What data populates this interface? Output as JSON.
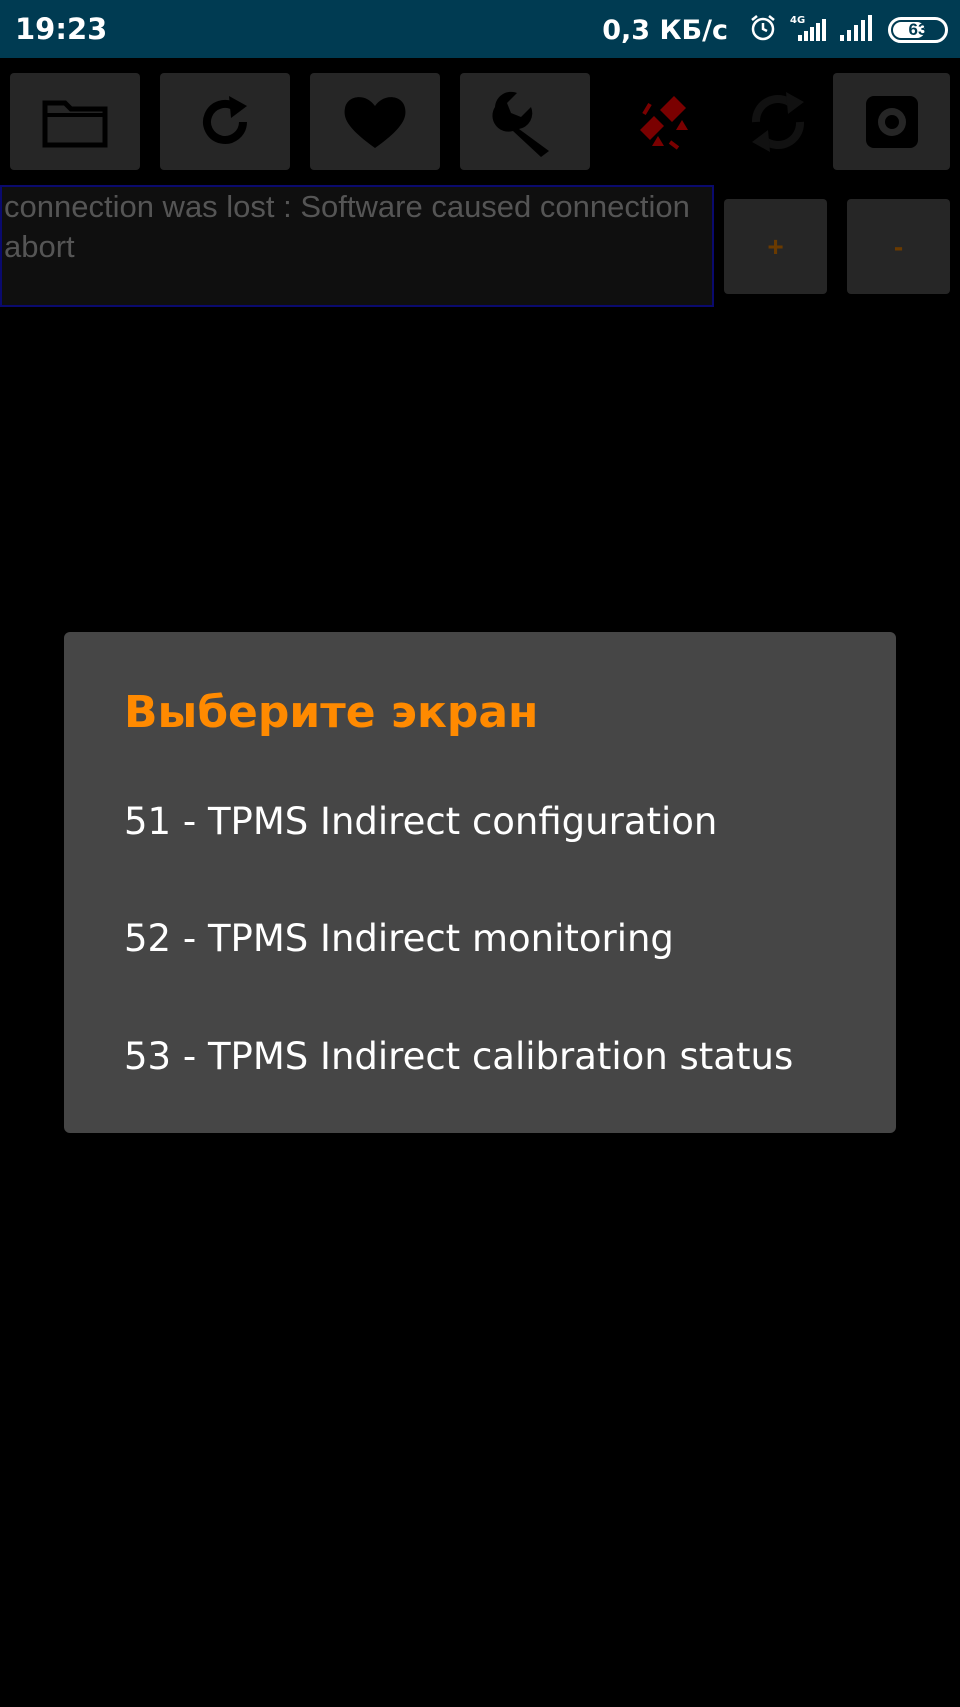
{
  "status_bar": {
    "time": "19:23",
    "network_speed": "0,3 КБ/с",
    "network_type": "4G",
    "battery_level": "63",
    "icons": [
      "alarm-icon",
      "signal-4g-icon",
      "signal-icon",
      "battery-icon"
    ]
  },
  "toolbar": {
    "buttons": [
      "folder-icon",
      "refresh-icon",
      "heart-icon",
      "wrench-icon",
      "connection-lost-icon",
      "sync-icon",
      "gear-icon"
    ]
  },
  "message": {
    "text": "connection was lost : Software caused connection abort"
  },
  "zoom": {
    "plus_label": "+",
    "minus_label": "-"
  },
  "dialog": {
    "title": "Выберите экран",
    "items": [
      {
        "label": "51 - TPMS Indirect configuration"
      },
      {
        "label": "52 - TPMS Indirect monitoring"
      },
      {
        "label": "53 - TPMS Indirect calibration status"
      }
    ]
  },
  "colors": {
    "status_bar_bg": "#003b52",
    "dialog_bg": "#464646",
    "dialog_title": "#ff8a00",
    "toolbar_button_bg": "#262626",
    "alert_icon": "#8b0000"
  }
}
